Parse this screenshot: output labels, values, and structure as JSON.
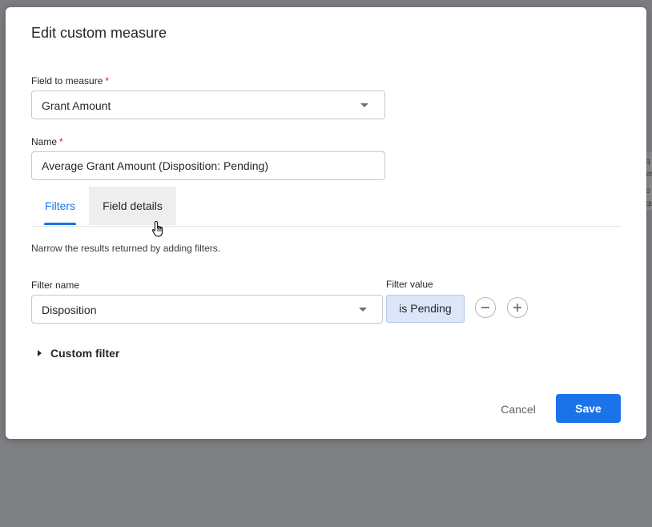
{
  "dialog": {
    "title": "Edit custom measure",
    "field_to_measure": {
      "label": "Field to measure",
      "required_mark": "*",
      "value": "Grant Amount"
    },
    "name": {
      "label": "Name",
      "required_mark": "*",
      "value": "Average Grant Amount (Disposition: Pending)"
    },
    "tabs": [
      {
        "label": "Filters",
        "active": true
      },
      {
        "label": "Field details",
        "active": false
      }
    ],
    "hint": "Narrow the results returned by adding filters.",
    "filter": {
      "name_label": "Filter name",
      "value_label": "Filter value",
      "name_value": "Disposition",
      "value_chip": "is Pending"
    },
    "custom_filter_label": "Custom filter",
    "actions": {
      "cancel": "Cancel",
      "save": "Save"
    }
  },
  "background_fragments": [
    "q",
    "ers",
    "o",
    "que"
  ],
  "colors": {
    "accent": "#1a73e8",
    "required": "#c5221f",
    "chip_bg": "#dce6f8",
    "overlay": "#7f8083"
  }
}
